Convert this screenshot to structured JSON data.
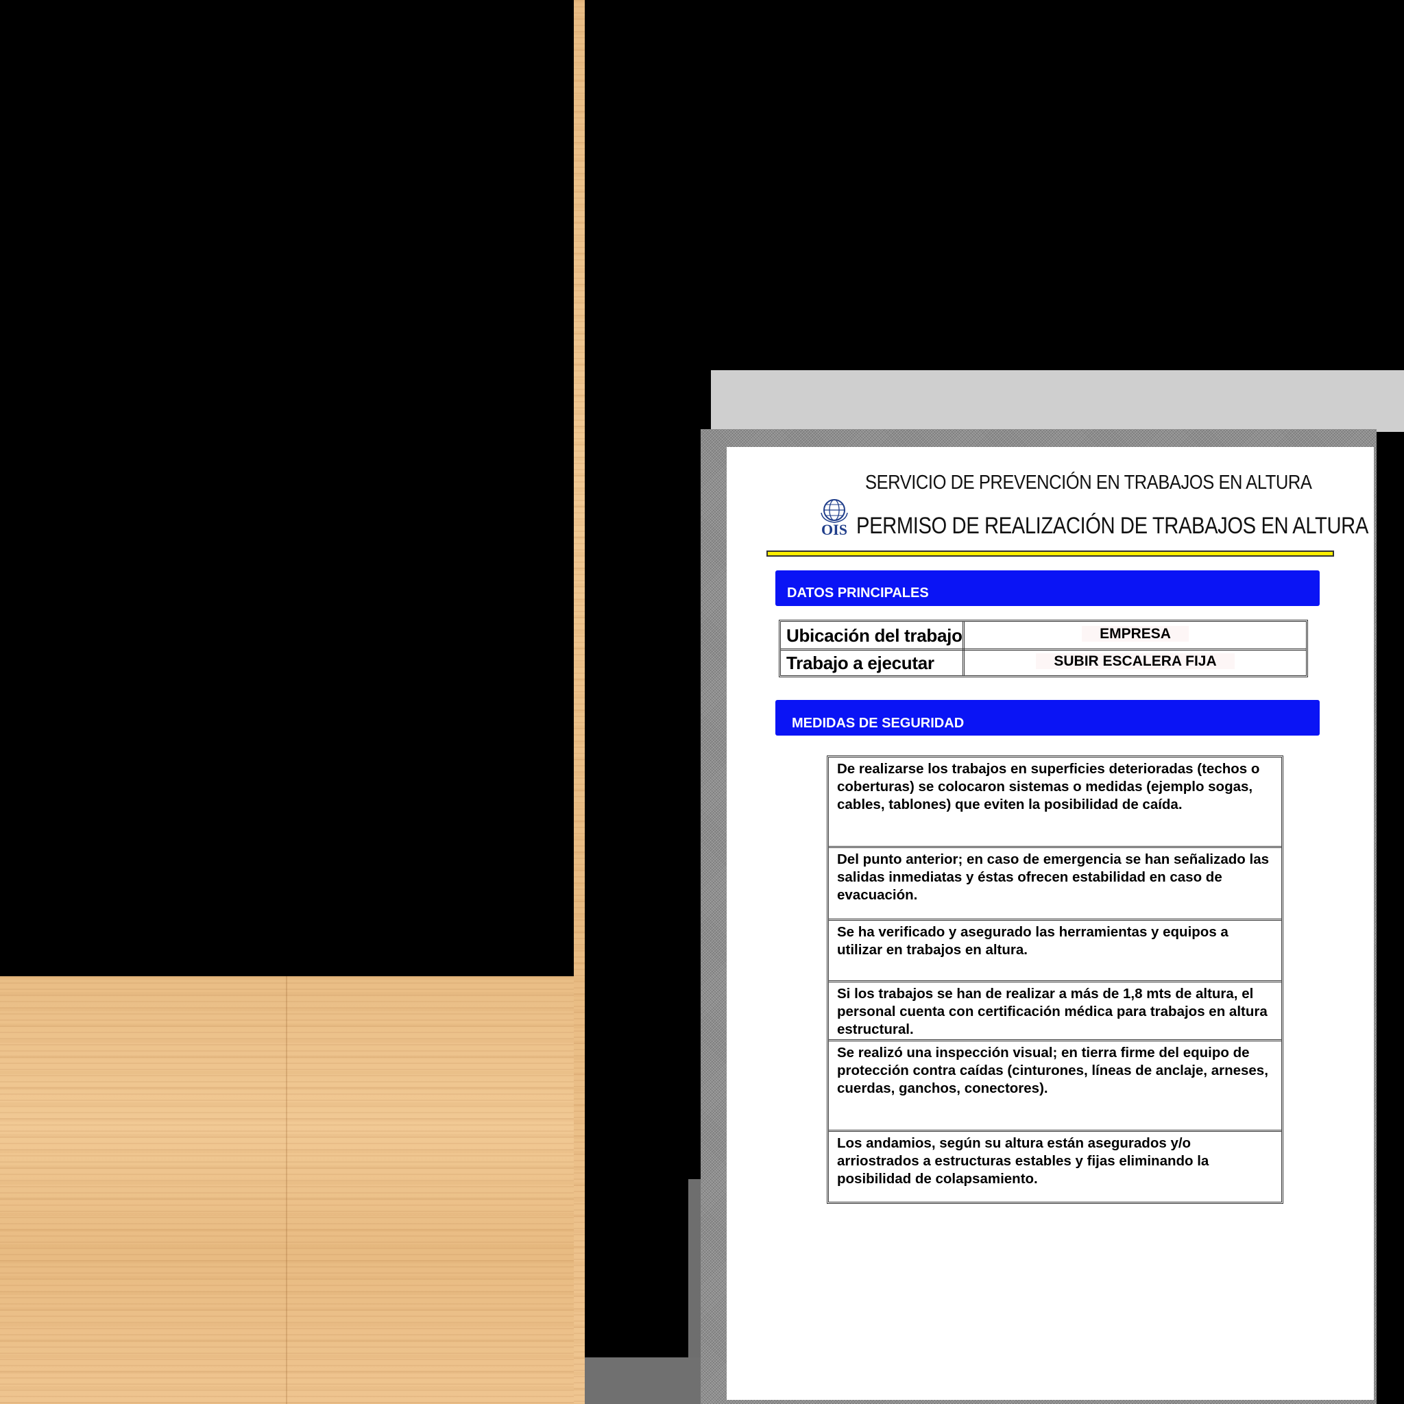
{
  "header": {
    "service_title": "SERVICIO DE PREVENCIÓN EN TRABAJOS EN ALTURA",
    "permit_title": "PERMISO DE REALIZACIÓN DE TRABAJOS EN ALTURA",
    "logo_text": "OIS"
  },
  "datos_principales": {
    "heading": "DATOS PRINCIPALES",
    "rows": [
      {
        "label": "Ubicación del trabajo",
        "value": "EMPRESA"
      },
      {
        "label": "Trabajo a ejecutar",
        "value": "SUBIR ESCALERA FIJA"
      }
    ]
  },
  "medidas_seguridad": {
    "heading": "MEDIDAS DE SEGURIDAD",
    "items": [
      "De realizarse los trabajos en superficies deterioradas (techos o coberturas) se colocaron sistemas o medidas (ejemplo sogas, cables, tablones) que eviten la posibilidad de caída.",
      "Del punto anterior; en caso de emergencia se han señalizado las salidas inmediatas y éstas ofrecen estabilidad en caso de evacuación.",
      "Se ha verificado y asegurado las herramientas y equipos a utilizar en trabajos en altura.",
      "Si los trabajos se han de realizar a más de 1,8 mts de altura, el personal cuenta con certificación médica para trabajos en altura estructural.",
      "Se realizó una inspección visual; en tierra firme del equipo de protección contra caídas (cinturones, líneas de anclaje, arneses, cuerdas, ganchos, conectores).",
      "Los andamios, según su altura están asegurados y/o arriostrados a estructuras estables y fijas eliminando la posibilidad de colapsamiento."
    ]
  },
  "colors": {
    "section_bar": "#0a14f5",
    "rule_yellow": "#ffef00",
    "logo_blue": "#1f3d8a",
    "wood": "#efc590"
  }
}
